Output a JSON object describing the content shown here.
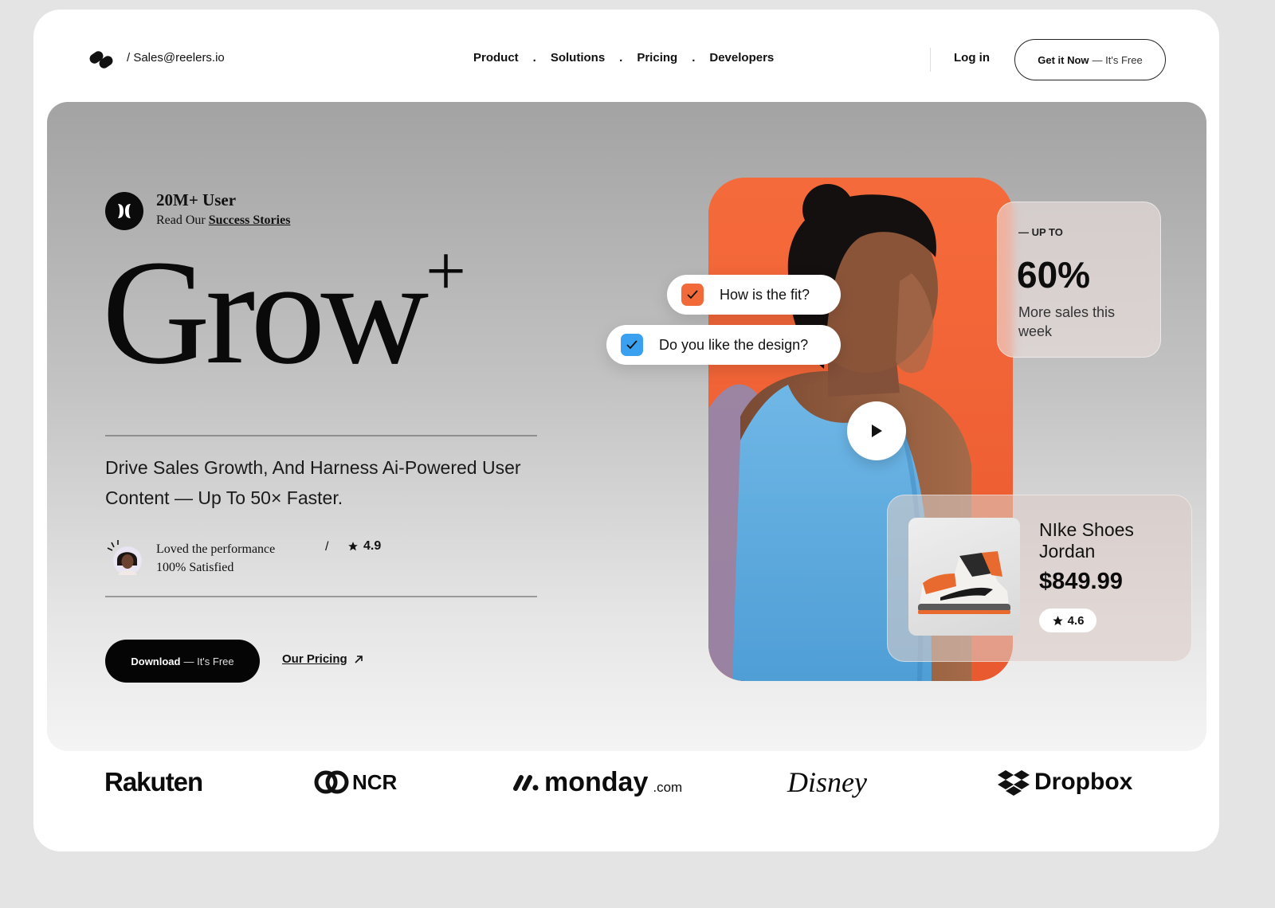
{
  "nav": {
    "email": "/ Sales@reelers.io",
    "links": [
      "Product",
      "Solutions",
      "Pricing",
      "Developers"
    ],
    "separator": ".",
    "login": "Log in",
    "cta_bold": "Get it Now",
    "cta_thin": "— It's Free"
  },
  "hero": {
    "users": "20M+ User",
    "stories_prefix": "Read Our",
    "stories_link": "Success Stories",
    "headline": "Grow",
    "headline_sup": "+",
    "tagline": "Drive Sales Growth, And Harness Ai-Powered User Content — Up To 50× Faster.",
    "testimonial_line1": "Loved the performance",
    "testimonial_line2": "100% Satisfied",
    "slash": "/",
    "rating": "4.9",
    "download_bold": "Download",
    "download_thin": "— It's Free",
    "pricing_link": "Our Pricing"
  },
  "visual": {
    "pill1": "How is the fit?",
    "pill2": "Do you like the design?",
    "stat_label": "— UP TO",
    "stat_value": "60%",
    "stat_desc": "More sales this week",
    "product_name": "NIke Shoes Jordan",
    "product_price": "$849.99",
    "product_rating": "4.6"
  },
  "logos": {
    "rakuten": "Rakuten",
    "ncr": "NCR",
    "monday": "monday",
    "monday_suffix": ".com",
    "disney": "Disney",
    "dropbox": "Dropbox"
  },
  "colors": {
    "accent_orange": "#f26a3a",
    "accent_blue": "#3aa0f0",
    "dark": "#050505"
  }
}
